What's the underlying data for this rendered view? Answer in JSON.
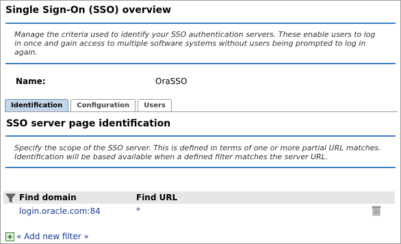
{
  "page": {
    "title": "Single Sign-On (SSO) overview",
    "description": "Manage the criteria used to identify your SSO authentication servers. These enable users to log in once and gain access to multiple software systems without users being prompted to log in again.",
    "name_label": "Name:",
    "name_value": "OraSSO"
  },
  "tabs": [
    {
      "label": "Identification",
      "active": true
    },
    {
      "label": "Configuration",
      "active": false
    },
    {
      "label": "Users",
      "active": false
    }
  ],
  "section": {
    "title": "SSO server page identification",
    "description": "Specify the scope of the SSO server. This is defined in terms of one or more partial URL matches. Identification will be based available when a defined filter matches the server URL."
  },
  "grid": {
    "columns": {
      "domain": "Find domain",
      "url": "Find URL"
    },
    "rows": [
      {
        "domain": "login.oracle.com:84",
        "url": "*"
      }
    ]
  },
  "add_filter_label": "« Add new filter »",
  "colors": {
    "accent": "#3b7fc4",
    "link": "#1a3a9a",
    "tab_active": "#c3d6ea"
  }
}
